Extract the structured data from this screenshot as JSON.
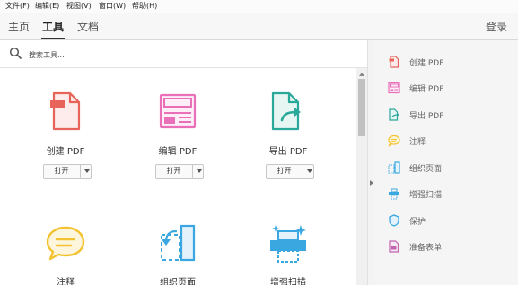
{
  "menu": {
    "file": "文件(F)",
    "edit": "编辑(E)",
    "view": "视图(V)",
    "window": "窗口(W)",
    "help": "帮助(H)"
  },
  "nav": {
    "home": "主页",
    "tools": "工具",
    "documents": "文档",
    "login": "登录",
    "active_tab": "工具"
  },
  "search": {
    "placeholder": "搜索工具..."
  },
  "tools": [
    {
      "label": "创建 PDF",
      "button": "打开",
      "icon": "create-pdf-icon",
      "color": "#e8645a"
    },
    {
      "label": "编辑 PDF",
      "button": "打开",
      "icon": "edit-pdf-icon",
      "color": "#e86fb8"
    },
    {
      "label": "导出 PDF",
      "button": "打开",
      "icon": "export-pdf-icon",
      "color": "#2aa89a"
    },
    {
      "label": "注释",
      "icon": "comment-icon",
      "color": "#f2c230"
    },
    {
      "label": "组织页面",
      "icon": "organize-pages-icon",
      "color": "#3aa7e0"
    },
    {
      "label": "增强扫描",
      "icon": "enhance-scan-icon",
      "color": "#3aa7e0"
    }
  ],
  "right_panel": {
    "items": [
      {
        "label": "创建 PDF",
        "icon": "create-pdf-icon",
        "color": "#e8645a"
      },
      {
        "label": "编辑 PDF",
        "icon": "edit-pdf-icon",
        "color": "#e86fb8"
      },
      {
        "label": "导出 PDF",
        "icon": "export-pdf-icon",
        "color": "#2aa89a"
      },
      {
        "label": "注释",
        "icon": "comment-icon",
        "color": "#f2c230"
      },
      {
        "label": "组织页面",
        "icon": "organize-pages-icon",
        "color": "#3aa7e0"
      },
      {
        "label": "增强扫描",
        "icon": "enhance-scan-icon",
        "color": "#3aa7e0"
      },
      {
        "label": "保护",
        "icon": "shield-icon",
        "color": "#3aa7e0"
      },
      {
        "label": "准备表单",
        "icon": "prepare-form-icon",
        "color": "#c065b0"
      }
    ]
  }
}
